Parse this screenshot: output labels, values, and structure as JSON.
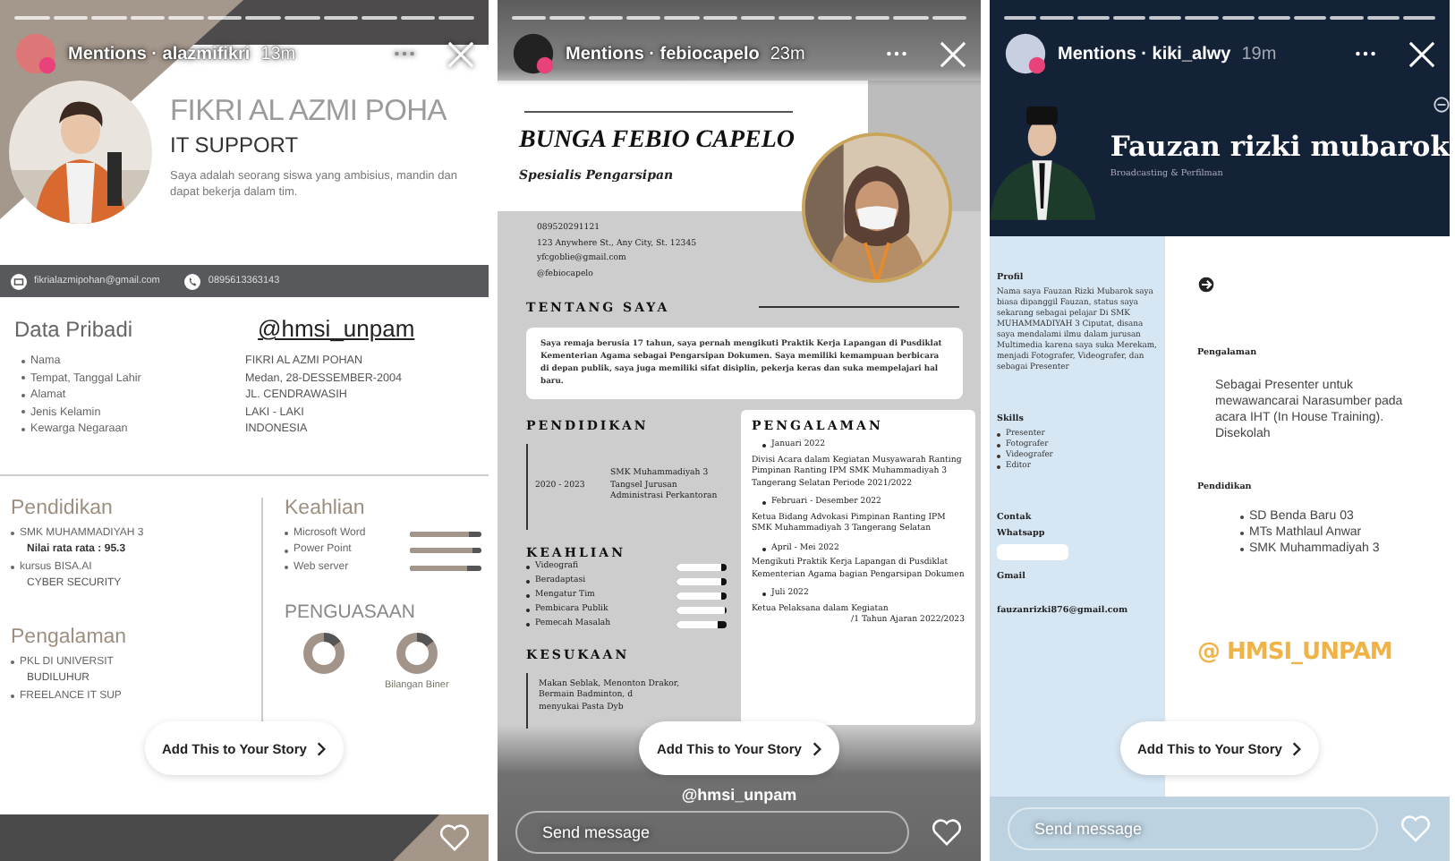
{
  "stories": [
    {
      "kind": "classic",
      "header": {
        "label": "Mentions · alazmifikri",
        "time": "13m"
      },
      "cta": "Add This to Your Story",
      "resume": {
        "name": "FIKRI AL AZMI POHA",
        "role": "IT SUPPORT",
        "summary": "Saya adalah seorang siswa yang ambisius, mandin dan dapat bekerja dalam tim.",
        "email": "fikrialazmipohan@gmail.com",
        "phone": "0895613363143",
        "personal_title": "Data Pribadi",
        "tag": "@hmsi_unpam",
        "personal": [
          {
            "label": "Nama",
            "value": "FIKRI AL AZMI POHAN"
          },
          {
            "label": "Tempat, Tanggal Lahir",
            "value": "Medan, 28-DESSEMBER-2004"
          },
          {
            "label": "Alamat",
            "value": "JL. CENDRAWASIH"
          },
          {
            "label": "Jenis Kelamin",
            "value": "LAKI - LAKI"
          },
          {
            "label": "Kewarga Negaraan",
            "value": "INDONESIA"
          }
        ],
        "education_title": "Pendidikan",
        "education": [
          {
            "name": "SMK MUHAMMADIYAH 3",
            "note": "Nilai rata rata : 95.3"
          },
          {
            "name": "kursus BISA.AI",
            "note": "CYBER SECURITY"
          }
        ],
        "experience_title": "Pengalaman",
        "experience": [
          {
            "name": "PKL DI UNIVERSIT",
            "note": "BUDILUHUR"
          },
          {
            "name": "FREELANCE IT SUP"
          }
        ],
        "skills_title": "Keahlian",
        "skills": [
          {
            "name": "Microsoft Word",
            "level": 0.82
          },
          {
            "name": "Power Point",
            "level": 0.88
          },
          {
            "name": "Web server",
            "level": 0.8
          }
        ],
        "mastery_title": "PENGUASAAN",
        "mastery": [
          {
            "kind": "donut"
          },
          {
            "kind": "donut",
            "label": "Bilangan Biner"
          }
        ]
      }
    },
    {
      "kind": "mono",
      "header": {
        "label": "Mentions · febiocapelo",
        "time": "23m"
      },
      "cta": "Add This to Your Story",
      "sticker": "@hmsi_unpam",
      "placeholder": "Send message",
      "resume": {
        "name": "BUNGA FEBIO CAPELO",
        "role": "Spesialis Pengarsipan",
        "contacts": [
          "089520291121",
          "123 Anywhere St., Any City, St. 12345",
          "yfcgoblie@gmail.com",
          "@febiocapelo"
        ],
        "about_title": "TENTANG SAYA",
        "about": "Saya remaja berusia 17 tahun, saya pernah mengikuti Praktik Kerja Lapangan di Pusdiklat Kementerian Agama sebagai Pengarsipan Dokumen. Saya memiliki kemampuan berbicara di depan publik, saya juga memiliki sifat disiplin, pekerja keras dan suka mempelajari hal baru.",
        "education_title": "PENDIDIKAN",
        "education": [
          {
            "years": "2020 - 2023",
            "school": "SMK Muhammadiyah 3 Tangsel Jurusan Administrasi Perkantoran"
          }
        ],
        "skills_title": "KEAHLIAN",
        "skills": [
          {
            "name": "Videografi",
            "level": 0.88
          },
          {
            "name": "Beradaptasi",
            "level": 0.88
          },
          {
            "name": "Mengatur Tim",
            "level": 0.88
          },
          {
            "name": "Pembicara Publik",
            "level": 0.95
          },
          {
            "name": "Pemecah Masalah",
            "level": 0.82
          }
        ],
        "hobbies_title": "KESUKAAN",
        "hobbies": [
          "Makan Seblak, Menonton Drakor,",
          "Bermain Badminton, d",
          "menyukai Pasta Dyb"
        ],
        "experience_title": "PENGALAMAN",
        "experience": [
          {
            "date": "Januari 2022",
            "lines": [
              "Divisi Acara dalam Kegiatan Musyawarah Ranting Pimpinan Ranting IPM SMK Muhammadiyah 3 Tangerang Selatan Periode 2021/2022"
            ]
          },
          {
            "date": "Februari - Desember 2022",
            "lines": [
              "Ketua Bidang Advokasi Pimpinan Ranting IPM SMK Muhammadiyah 3 Tangerang Selatan"
            ]
          },
          {
            "date": "April - Mei 2022",
            "lines": [
              "Mengikuti Praktik Kerja Lapangan di Pusdiklat Kementerian Agama bagian Pengarsipan Dokumen"
            ]
          },
          {
            "date": "Juli 2022",
            "lines": [
              "Ketua Pelaksana dalam Kegiatan",
              "/1 Tahun Ajaran 2022/2023"
            ]
          }
        ]
      }
    },
    {
      "kind": "navy",
      "header": {
        "label": "Mentions · kiki_alwy",
        "time": "19m"
      },
      "cta": "Add This to Your Story",
      "placeholder": "Send message",
      "resume": {
        "name": "Fauzan rizki mubarok",
        "role": "Broadcasting & Perfilman",
        "profile_title": "Profil",
        "profile": "Nama saya Fauzan Rizki Mubarok saya biasa dipanggil Fauzan, status saya sekarang sebagai pelajar Di SMK MUHAMMADIYAH 3 Ciputat, disana saya mendalami ilmu dalam jurusan Multimedia karena saya suka Merekam, menjadi Fotografer, Videografer, dan sebagai Presenter",
        "skills_title": "Skills",
        "skills": [
          "Presenter",
          "Fotografer",
          "Videografer",
          "Editor"
        ],
        "contact_title": "Contak",
        "whatsapp_label": "Whatsapp",
        "whatsapp_redacted": true,
        "gmail_label": "Gmail",
        "email": "fauzanrizki876@gmail.com",
        "experience_title": "Pengalaman",
        "experience": "Sebagai Presenter untuk mewawancarai Narasumber pada acara IHT (In House Training). Disekolah",
        "education_title": "Pendidikan",
        "education": [
          "SD Benda Baru 03",
          "MTs Mathlaul Anwar",
          "SMK Muhammadiyah 3"
        ],
        "sticker": "@ HMSI_UNPAM"
      }
    }
  ]
}
